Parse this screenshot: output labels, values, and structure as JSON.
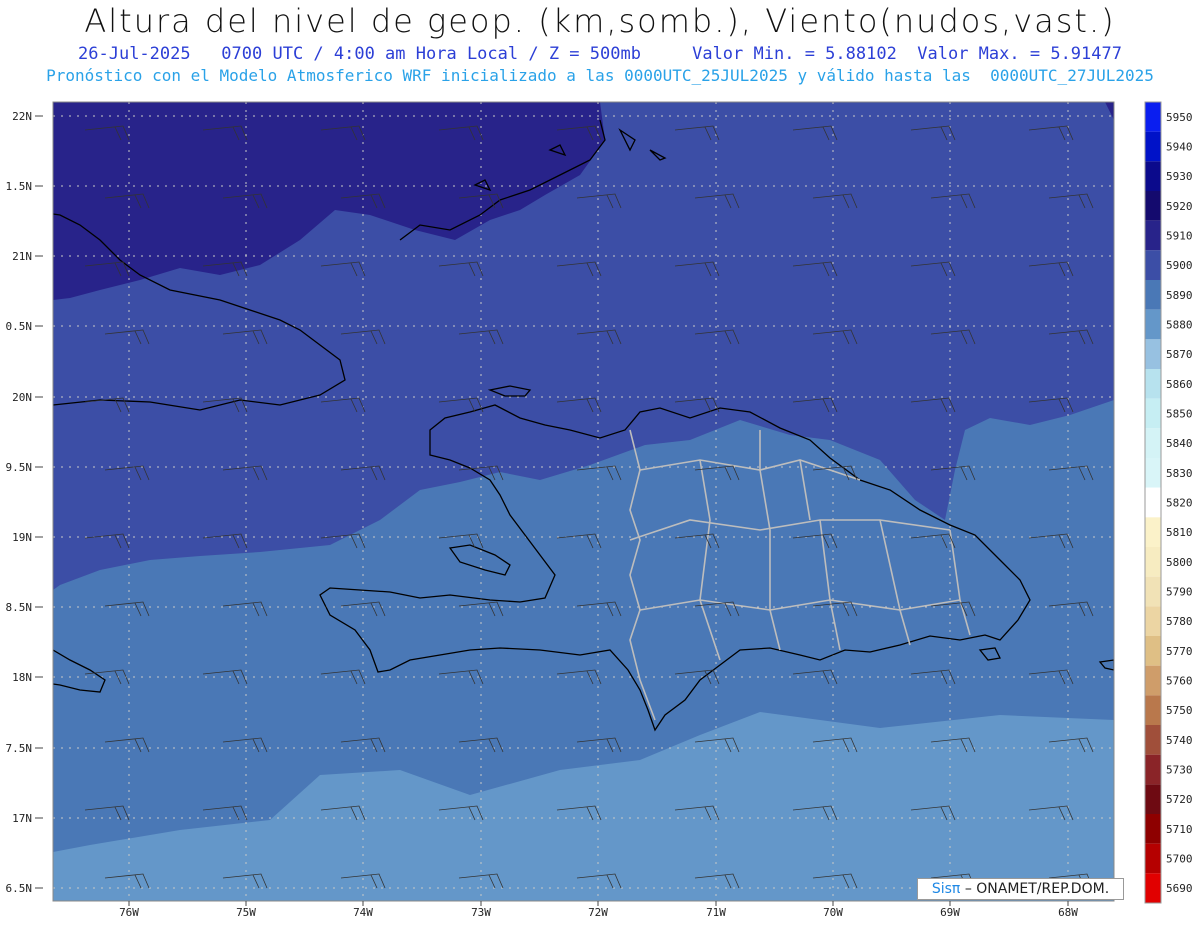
{
  "header": {
    "title": "Altura del nivel de geop. (km,somb.), Viento(nudos,vast.)",
    "line1": "26-Jul-2025   0700 UTC / 4:00 am Hora Local / Z = 500mb     Valor Min. = 5.88102  Valor Max. = 5.91477",
    "line2": "Pronóstico con el Modelo Atmosferico WRF inicializado a las 0000UTC_25JUL2025 y válido hasta las  0000UTC_27JUL2025"
  },
  "axes": {
    "lat_labels": [
      "22N",
      "1.5N",
      "21N",
      "0.5N",
      "20N",
      "9.5N",
      "19N",
      "8.5N",
      "18N",
      "7.5N",
      "17N",
      "6.5N"
    ],
    "lon_labels": [
      "76W",
      "75W",
      "74W",
      "73W",
      "72W",
      "71W",
      "70W",
      "69W",
      "68W"
    ]
  },
  "legend": {
    "levels": [
      {
        "label": "5950",
        "color": "#0a1ef0"
      },
      {
        "label": "5940",
        "color": "#0012c8"
      },
      {
        "label": "5930",
        "color": "#0b0a8c"
      },
      {
        "label": "5920",
        "color": "#140a6e"
      },
      {
        "label": "5910",
        "color": "#28238a"
      },
      {
        "label": "5900",
        "color": "#3c4ea6"
      },
      {
        "label": "5890",
        "color": "#4a78b6"
      },
      {
        "label": "5880",
        "color": "#6497c9"
      },
      {
        "label": "5870",
        "color": "#97c1e1"
      },
      {
        "label": "5860",
        "color": "#b7e2ee"
      },
      {
        "label": "5850",
        "color": "#c6eef3"
      },
      {
        "label": "5840",
        "color": "#d4f3f6"
      },
      {
        "label": "5830",
        "color": "#d9f5f8"
      },
      {
        "label": "5820",
        "color": "#ffffff"
      },
      {
        "label": "5810",
        "color": "#fbf2c9"
      },
      {
        "label": "5800",
        "color": "#f7ecc1"
      },
      {
        "label": "5790",
        "color": "#f1e2b6"
      },
      {
        "label": "5780",
        "color": "#ecd5a3"
      },
      {
        "label": "5770",
        "color": "#dfbf85"
      },
      {
        "label": "5760",
        "color": "#cf9d6a"
      },
      {
        "label": "5750",
        "color": "#b9784c"
      },
      {
        "label": "5740",
        "color": "#a04f3a"
      },
      {
        "label": "5730",
        "color": "#8a2428"
      },
      {
        "label": "5720",
        "color": "#6e0a12"
      },
      {
        "label": "5710",
        "color": "#8e0000"
      },
      {
        "label": "5700",
        "color": "#b50000"
      },
      {
        "label": "5690",
        "color": "#e10000"
      }
    ]
  },
  "credit": {
    "brand": "Sisπ",
    "text": "– ONAMET/REP.DOM."
  },
  "colors": {
    "zone_5910": "#28238a",
    "zone_5900": "#3c4ea6",
    "zone_5890": "#4a78b6",
    "zone_5880": "#6497c9",
    "coast": "#000000",
    "provinces": "#bdbdbd",
    "grid": "#c8c8c8"
  }
}
